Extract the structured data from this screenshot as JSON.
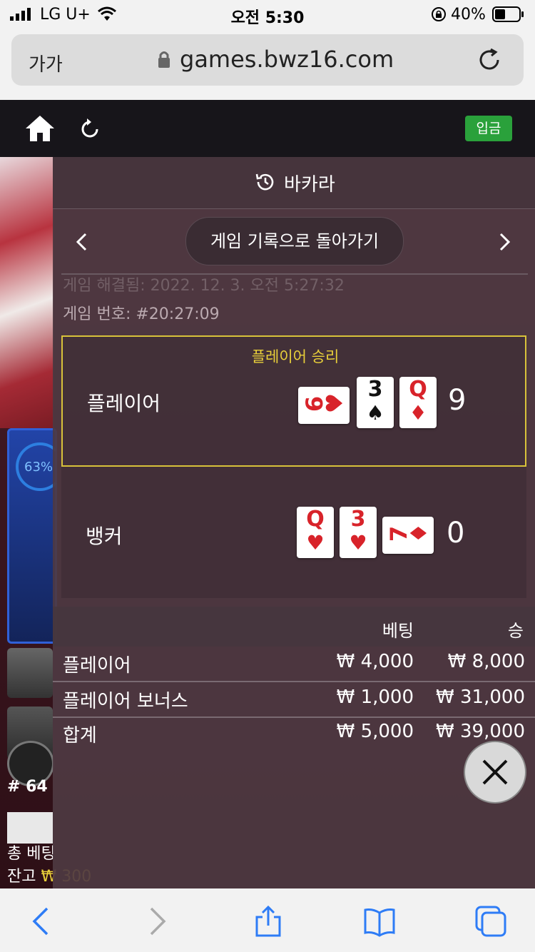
{
  "status_bar": {
    "carrier": "LG U+",
    "time": "오전 5:30",
    "battery": "40%"
  },
  "browser": {
    "text_size_label": "가가",
    "url": "games.bwz16.com"
  },
  "header": {
    "deposit_label": "입금"
  },
  "background": {
    "percent": "63%",
    "round_label": "# 64",
    "total_bet_label": "총 베팅",
    "balance_label": "잔고",
    "balance_value": "₩ 300"
  },
  "history": {
    "title": "바카라",
    "back_button": "게임 기록으로 돌아가기",
    "game_time": "게임 해결됨: 2022. 12. 3. 오전 5:27:32",
    "game_number": "게임 번호: #20:27:09",
    "result_banner": "플레이어 승리",
    "player": {
      "label": "플레이어",
      "score": "9",
      "cards": [
        {
          "rank": "6",
          "suit": "♥",
          "color": "red",
          "orientation": "horizontal"
        },
        {
          "rank": "3",
          "suit": "♠",
          "color": "black",
          "orientation": "vertical"
        },
        {
          "rank": "Q",
          "suit": "♦",
          "color": "red",
          "orientation": "vertical"
        }
      ]
    },
    "banker": {
      "label": "뱅커",
      "score": "0",
      "cards": [
        {
          "rank": "Q",
          "suit": "♥",
          "color": "red",
          "orientation": "vertical"
        },
        {
          "rank": "3",
          "suit": "♥",
          "color": "red",
          "orientation": "vertical"
        },
        {
          "rank": "7",
          "suit": "♦",
          "color": "red",
          "orientation": "horizontal"
        }
      ]
    },
    "bets": {
      "col_bet": "베팅",
      "col_win": "승",
      "rows": [
        {
          "name": "플레이어",
          "bet": "₩ 4,000",
          "win": "₩ 8,000"
        },
        {
          "name": "플레이어 보너스",
          "bet": "₩ 1,000",
          "win": "₩ 31,000"
        },
        {
          "name": "합계",
          "bet": "₩ 5,000",
          "win": "₩ 39,000"
        }
      ]
    }
  },
  "colors": {
    "win_highlight": "#d8c23a",
    "deposit_green": "#2aa13b",
    "card_red": "#d8232a",
    "ios_blue": "#2e7cf6"
  }
}
